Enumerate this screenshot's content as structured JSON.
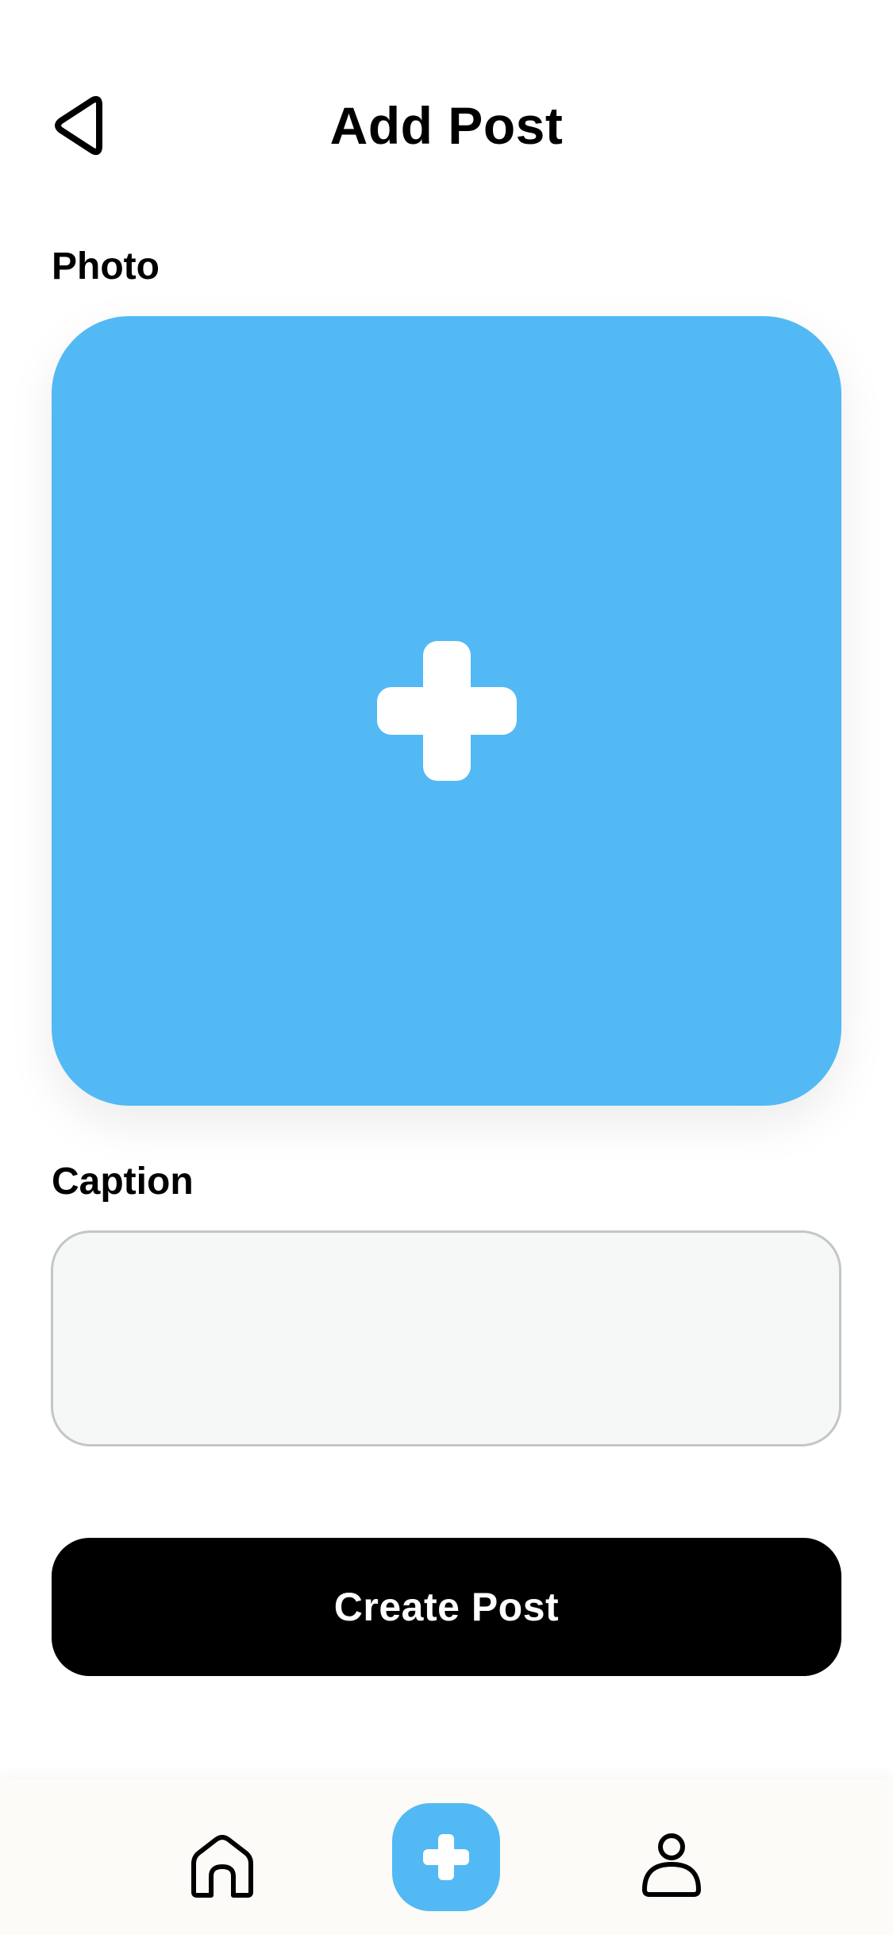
{
  "header": {
    "title": "Add Post",
    "back_icon": "back-triangle-icon"
  },
  "photo": {
    "label": "Photo",
    "add_icon": "plus-icon"
  },
  "caption": {
    "label": "Caption",
    "value": "",
    "placeholder": ""
  },
  "actions": {
    "create_label": "Create Post"
  },
  "bottom_nav": {
    "items": [
      {
        "name": "Home",
        "icon": "home-icon"
      },
      {
        "name": "Add",
        "icon": "plus-icon",
        "active": true
      },
      {
        "name": "Profile",
        "icon": "user-icon"
      }
    ]
  },
  "colors": {
    "accent": "#53b9f4",
    "primary_button": "#000000",
    "caption_bg": "#f6f8f8",
    "caption_border": "#c4c6c6",
    "nav_bg": "#fcfbf7"
  }
}
